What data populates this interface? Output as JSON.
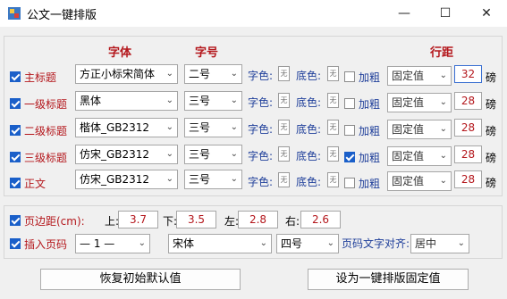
{
  "window": {
    "title": "公文一键排版",
    "minimize_glyph": "—",
    "maximize_glyph": "☐",
    "close_glyph": "✕"
  },
  "headers": {
    "font": "字体",
    "size": "字号",
    "line_spacing": "行距"
  },
  "rows": [
    {
      "label": "主标题",
      "checked": true,
      "font": "方正小标宋简体",
      "size": "二号",
      "color_label": "字色:",
      "bg_label": "底色:",
      "bold_label": "加粗",
      "bold": false,
      "spacing_mode": "固定值",
      "spacing_value": "32",
      "unit": "磅"
    },
    {
      "label": "一级标题",
      "checked": true,
      "font": "黑体",
      "size": "三号",
      "color_label": "字色:",
      "bg_label": "底色:",
      "bold_label": "加粗",
      "bold": false,
      "spacing_mode": "固定值",
      "spacing_value": "28",
      "unit": "磅"
    },
    {
      "label": "二级标题",
      "checked": true,
      "font": "楷体_GB2312",
      "size": "三号",
      "color_label": "字色:",
      "bg_label": "底色:",
      "bold_label": "加粗",
      "bold": false,
      "spacing_mode": "固定值",
      "spacing_value": "28",
      "unit": "磅"
    },
    {
      "label": "三级标题",
      "checked": true,
      "font": "仿宋_GB2312",
      "size": "三号",
      "color_label": "字色:",
      "bg_label": "底色:",
      "bold_label": "加粗",
      "bold": true,
      "spacing_mode": "固定值",
      "spacing_value": "28",
      "unit": "磅"
    },
    {
      "label": "正文",
      "checked": true,
      "font": "仿宋_GB2312",
      "size": "三号",
      "color_label": "字色:",
      "bg_label": "底色:",
      "bold_label": "加粗",
      "bold": false,
      "spacing_mode": "固定值",
      "spacing_value": "28",
      "unit": "磅"
    }
  ],
  "margins": {
    "label": "页边距(cm):",
    "checked": true,
    "top_label": "上:",
    "top": "3.7",
    "bottom_label": "下:",
    "bottom": "3.5",
    "left_label": "左:",
    "left": "2.8",
    "right_label": "右:",
    "right": "2.6"
  },
  "page_number": {
    "label": "插入页码",
    "checked": true,
    "style": "— 1 —",
    "font": "宋体",
    "size": "四号",
    "align_label": "页码文字对齐:",
    "align": "居中"
  },
  "buttons": {
    "restore": "恢复初始默认值",
    "set_fixed": "设为一键排版固定值"
  },
  "colors": {
    "accent_red": "#b4171c",
    "label_blue": "#1f3f9a",
    "check_blue": "#1a5fc9"
  }
}
